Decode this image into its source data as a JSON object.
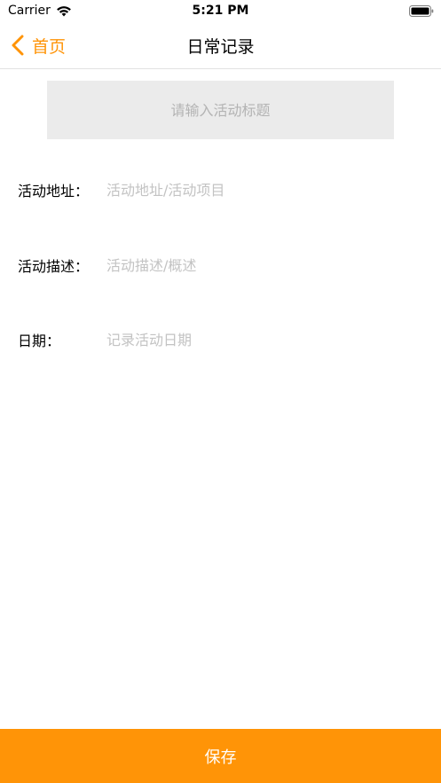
{
  "status_bar": {
    "carrier": "Carrier",
    "time": "5:21 PM"
  },
  "nav": {
    "back_label": "首页",
    "title": "日常记录"
  },
  "form": {
    "title_placeholder": "请输入活动标题",
    "address": {
      "label": "活动地址：",
      "placeholder": "活动地址/活动项目"
    },
    "description": {
      "label": "活动描述：",
      "placeholder": "活动描述/概述"
    },
    "date": {
      "label": "日期：",
      "placeholder": "记录活动日期"
    }
  },
  "footer": {
    "save_label": "保存"
  },
  "colors": {
    "accent": "#ff9407",
    "input_bg": "#ebebeb",
    "placeholder": "#c3c3c3"
  }
}
